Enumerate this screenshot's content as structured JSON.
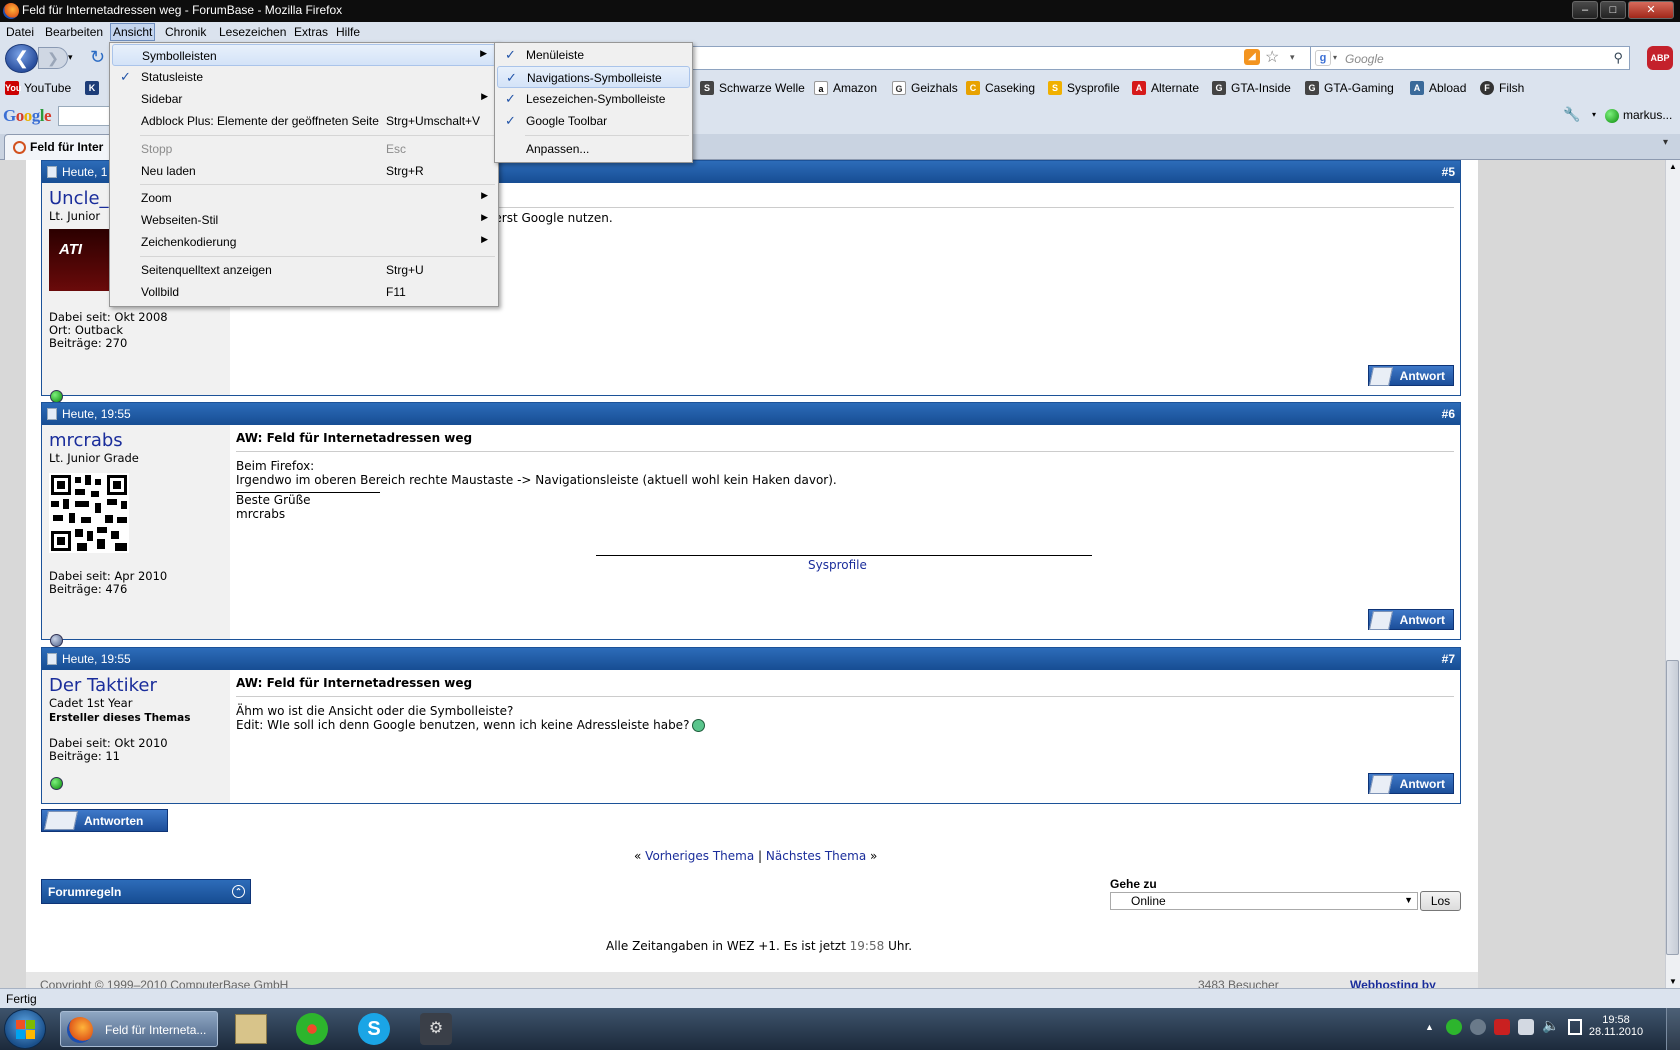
{
  "window": {
    "title": "Feld für Internetadressen weg - ForumBase - Mozilla Firefox",
    "min": "–",
    "max": "□",
    "close": "✕"
  },
  "menubar": [
    "Datei",
    "Bearbeiten",
    "Ansicht",
    "Chronik",
    "Lesezeichen",
    "Extras",
    "Hilfe"
  ],
  "search": {
    "placeholder": "Google"
  },
  "abp": "ABP",
  "bookmarks": [
    {
      "label": "YouTube",
      "icon": "You"
    },
    {
      "label": "Schwarze Welle",
      "icon": "S"
    },
    {
      "label": "Amazon",
      "icon": "a"
    },
    {
      "label": "Geizhals",
      "icon": "G"
    },
    {
      "label": "Caseking",
      "icon": "C"
    },
    {
      "label": "Sysprofile",
      "icon": "S"
    },
    {
      "label": "Alternate",
      "icon": "A"
    },
    {
      "label": "GTA-Inside",
      "icon": "G"
    },
    {
      "label": "GTA-Gaming",
      "icon": "G"
    },
    {
      "label": "Abload",
      "icon": "A"
    },
    {
      "label": "Filsh",
      "icon": "F"
    }
  ],
  "google_bar": {
    "logo": "Google",
    "user": "markus..."
  },
  "tab": {
    "label": "Feld für Inter"
  },
  "ansicht_menu": {
    "items": [
      {
        "label": "Symbolleisten",
        "shortcut": "",
        "submenu": true,
        "checked": false,
        "disabled": false
      },
      {
        "label": "Statusleiste",
        "shortcut": "",
        "submenu": false,
        "checked": true,
        "disabled": false
      },
      {
        "label": "Sidebar",
        "shortcut": "",
        "submenu": true,
        "checked": false,
        "disabled": false
      },
      {
        "label": "Adblock Plus: Elemente der geöffneten Seite",
        "shortcut": "Strg+Umschalt+V",
        "submenu": false,
        "checked": false,
        "disabled": false
      },
      {
        "label": "Stopp",
        "shortcut": "Esc",
        "submenu": false,
        "checked": false,
        "disabled": true
      },
      {
        "label": "Neu laden",
        "shortcut": "Strg+R",
        "submenu": false,
        "checked": false,
        "disabled": false
      },
      {
        "label": "Zoom",
        "shortcut": "",
        "submenu": true,
        "checked": false,
        "disabled": false
      },
      {
        "label": "Webseiten-Stil",
        "shortcut": "",
        "submenu": true,
        "checked": false,
        "disabled": false
      },
      {
        "label": "Zeichenkodierung",
        "shortcut": "",
        "submenu": true,
        "checked": false,
        "disabled": false
      },
      {
        "label": "Seitenquelltext anzeigen",
        "shortcut": "Strg+U",
        "submenu": false,
        "checked": false,
        "disabled": false
      },
      {
        "label": "Vollbild",
        "shortcut": "F11",
        "submenu": false,
        "checked": false,
        "disabled": false
      }
    ]
  },
  "symbolleisten_menu": {
    "items": [
      {
        "label": "Menüleiste",
        "checked": true
      },
      {
        "label": "Navigations-Symbolleiste",
        "checked": true
      },
      {
        "label": "Lesezeichen-Symbolleiste",
        "checked": true
      },
      {
        "label": "Google Toolbar",
        "checked": true
      },
      {
        "label": "Anpassen...",
        "checked": false
      }
    ]
  },
  "posts": [
    {
      "date": "Heute, 1",
      "num": "#5",
      "user": "Uncle_",
      "rank": "Lt. Junior",
      "avatar_text": "ATI",
      "joined": "Dabei seit: Okt 2008",
      "location": "Ort: Outback",
      "posts": "Beiträge: 270",
      "body_fragment": "n erst Google nutzen.",
      "status": "online"
    },
    {
      "date": "Heute, 19:55",
      "num": "#6",
      "user": "mrcrabs",
      "rank": "Lt. Junior Grade",
      "joined": "Dabei seit: Apr 2010",
      "posts": "Beiträge: 476",
      "title": "AW: Feld für Internetadressen weg",
      "body1": "Beim Firefox:",
      "body2": "Irgendwo im oberen Bereich rechte Maustaste -> Navigationsleiste (aktuell wohl kein Haken davor).",
      "sig1": "Beste Grüße",
      "sig2": "mrcrabs",
      "sig_link": "Sysprofile",
      "status": "offline"
    },
    {
      "date": "Heute, 19:55",
      "num": "#7",
      "user": "Der Taktiker",
      "rank": "Cadet 1st Year",
      "creator": "Ersteller dieses Themas",
      "joined": "Dabei seit: Okt 2010",
      "posts": "Beiträge: 11",
      "title": "AW: Feld für Internetadressen weg",
      "body1": "Ähm wo ist die Ansicht oder die Symbolleiste?",
      "body2": "Edit: WIe soll ich denn Google benutzen, wenn ich keine Adressleiste habe?",
      "status": "online"
    }
  ],
  "antwort": "Antwort",
  "antworten": "Antworten",
  "thread_nav": {
    "prev": "Vorheriges Thema",
    "sep": "|",
    "next": "Nächstes Thema",
    "lq": "«",
    "rq": "»"
  },
  "forumregeln": "Forumregeln",
  "gehe_zu": {
    "label": "Gehe zu",
    "selected": "Online",
    "button": "Los"
  },
  "timezone": {
    "prefix": "Alle Zeitangaben in WEZ +1. Es ist jetzt",
    "time": "19:58",
    "suffix": "Uhr."
  },
  "footer": {
    "copyright": "Copyright © 1999–2010 ComputerBase GmbH",
    "visitors": "3483 Besucher",
    "hosting": "Webhosting by"
  },
  "statusbar": "Fertig",
  "taskbar": {
    "task": "Feld für Interneta...",
    "time": "19:58",
    "date": "28.11.2010"
  },
  "colors": {
    "accent": "#1c5298",
    "link": "#1a2d9b",
    "chrome": "#dbe3ee"
  }
}
